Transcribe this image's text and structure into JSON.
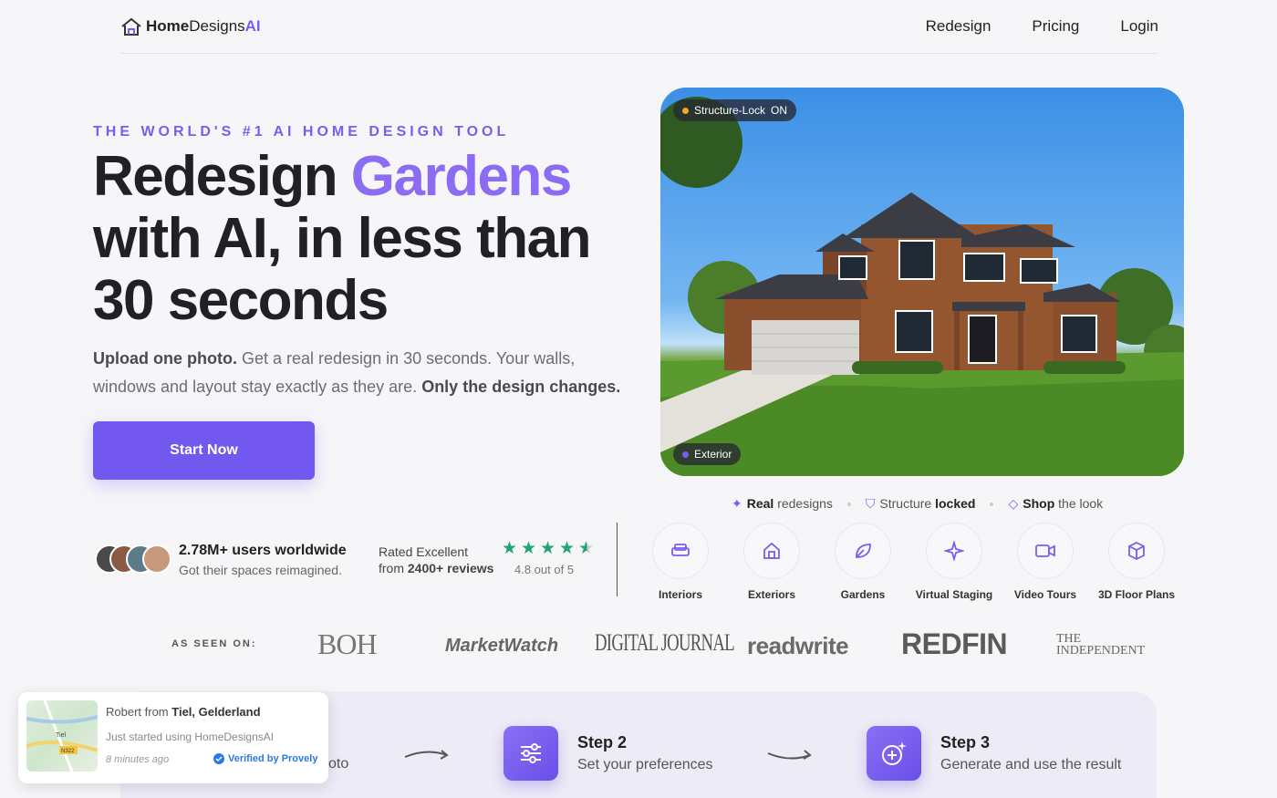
{
  "header": {
    "logo_home": "Home",
    "logo_designs": "Designs",
    "logo_ai": "AI",
    "nav": [
      "Redesign",
      "Pricing",
      "Login"
    ]
  },
  "hero": {
    "eyebrow": "THE WORLD'S #1 AI HOME DESIGN TOOL",
    "headline_pre": "Redesign",
    "headline_accent": "Gardens",
    "headline_rest": "with AI, in less than 30 seconds",
    "sub_bold1": "Upload one photo.",
    "sub_text": " Get a real redesign in 30 seconds. Your walls, windows and layout stay exactly as they are. ",
    "sub_bold2": "Only the design changes.",
    "cta": "Start Now"
  },
  "image": {
    "badge_top": "Structure-Lock",
    "badge_top_state": "ON",
    "badge_bottom": "Exterior"
  },
  "proof": {
    "users_title": "2.78M+ users worldwide",
    "users_sub": "Got their spaces reimagined.",
    "rated_title": "Rated Excellent",
    "rated_from": "from ",
    "rated_count": "2400+ reviews",
    "score": "4.8 out of 5",
    "rating_value": 4.8
  },
  "tags": [
    {
      "bold": "Real",
      "text": " redesigns",
      "icon": "sparkle-icon"
    },
    {
      "bold": "Structure",
      "text": " locked",
      "icon": "shield-check-icon"
    },
    {
      "bold": "Shop",
      "text": " the look",
      "icon": "diamond-icon"
    }
  ],
  "categories": [
    {
      "label": "Interiors",
      "icon": "sofa-icon"
    },
    {
      "label": "Exteriors",
      "icon": "house-icon"
    },
    {
      "label": "Gardens",
      "icon": "leaf-icon"
    },
    {
      "label": "Virtual Staging",
      "icon": "sparkle-icon"
    },
    {
      "label": "Video Tours",
      "icon": "video-icon"
    },
    {
      "label": "3D Floor Plans",
      "icon": "cube-icon"
    }
  ],
  "press": {
    "label": "AS SEEN ON:",
    "logos": [
      "BOH",
      "MarketWatch",
      "DIGITAL JOURNAL",
      "readwrite",
      "REDFIN",
      "THE INDEPENDENT"
    ]
  },
  "steps": [
    {
      "title": "Step 2",
      "desc": "Set your preferences"
    },
    {
      "title": "Step 3",
      "desc": "Generate and use the result"
    }
  ],
  "step1_peek": "oto",
  "toast": {
    "name": "Robert from ",
    "place": "Tiel, Gelderland",
    "action": "Just started using HomeDesignsAI",
    "time": "8 minutes ago",
    "verified": "Verified by Provely",
    "map_label": "Tiel",
    "road_label": "N322"
  },
  "colors": {
    "accent": "#7358ef",
    "star": "#1ea672"
  }
}
